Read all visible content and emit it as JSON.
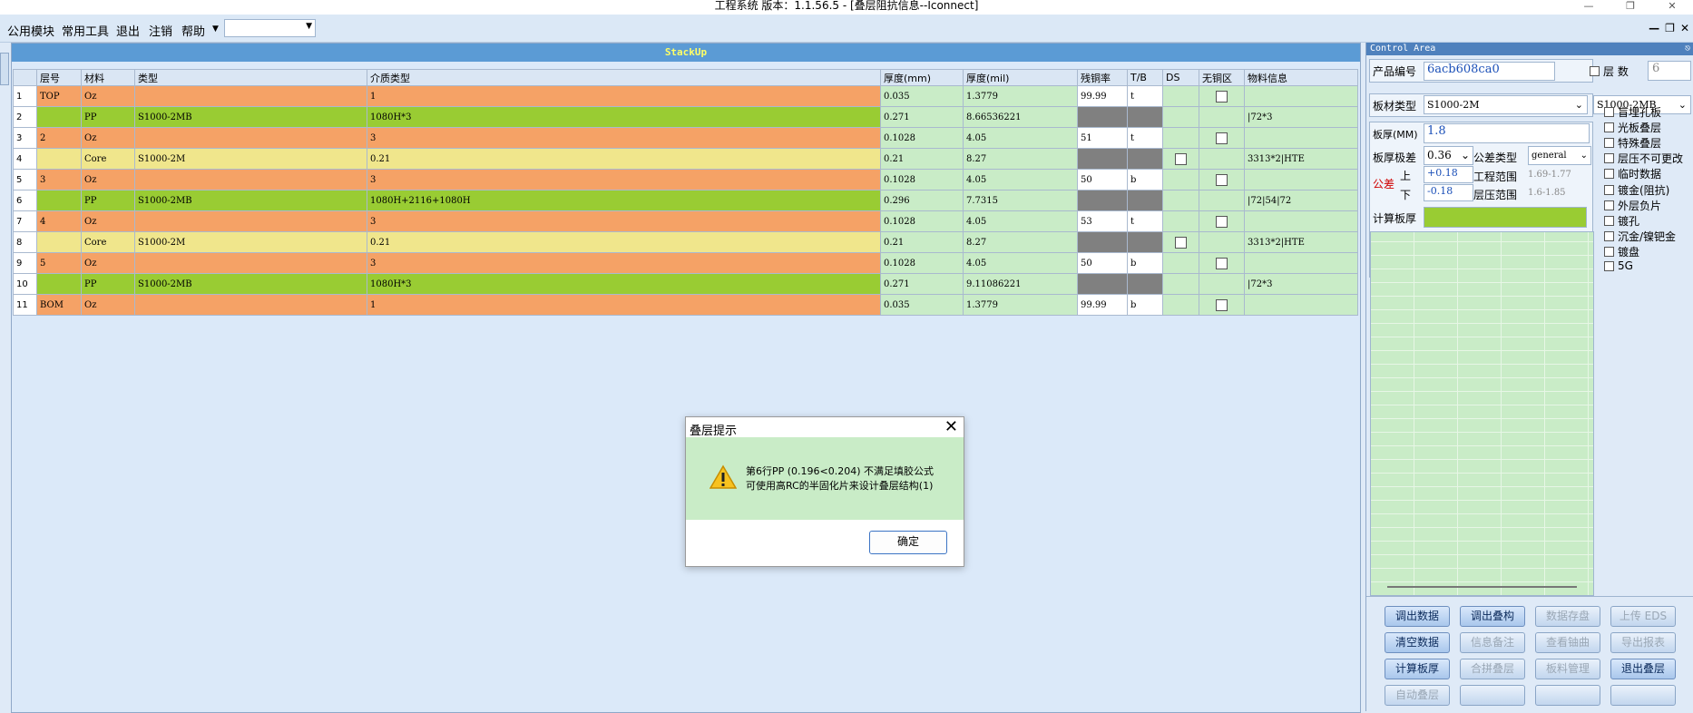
{
  "window": {
    "title": "工程系统   版本：1.1.56.5 - [叠层阻抗信息--Iconnect]"
  },
  "menu": {
    "items": [
      "公用模块",
      "常用工具",
      "退出",
      "注销",
      "帮助"
    ],
    "combo_value": ""
  },
  "stackup": {
    "title": "StackUp",
    "columns": [
      "层号",
      "材料",
      "类型",
      "介质类型",
      "厚度(mm)",
      "厚度(mil)",
      "残铜率",
      "T/B",
      "DS",
      "无铜区",
      "物料信息"
    ],
    "rows": [
      {
        "n": "1",
        "layer": "TOP",
        "mat": "Oz",
        "type": "",
        "diel": "1",
        "mm": "0.035",
        "mil": "1.3779",
        "cu": "99.99",
        "tb": "t",
        "info": ""
      },
      {
        "n": "2",
        "layer": "",
        "mat": "PP",
        "type": "S1000-2MB",
        "diel": "1080H*3",
        "mm": "0.271",
        "mil": "8.66536221",
        "cu": "",
        "tb": "",
        "info": "|72*3"
      },
      {
        "n": "3",
        "layer": "2",
        "mat": "Oz",
        "type": "",
        "diel": "3",
        "mm": "0.1028",
        "mil": "4.05",
        "cu": "51",
        "tb": "t",
        "info": ""
      },
      {
        "n": "4",
        "layer": "",
        "mat": "Core",
        "type": "S1000-2M",
        "diel": "0.21",
        "mm": "0.21",
        "mil": "8.27",
        "cu": "",
        "tb": "",
        "info": "3313*2|HTE"
      },
      {
        "n": "5",
        "layer": "3",
        "mat": "Oz",
        "type": "",
        "diel": "3",
        "mm": "0.1028",
        "mil": "4.05",
        "cu": "50",
        "tb": "b",
        "info": ""
      },
      {
        "n": "6",
        "layer": "",
        "mat": "PP",
        "type": "S1000-2MB",
        "diel": "1080H+2116+1080H",
        "mm": "0.296",
        "mil": "7.7315",
        "cu": "",
        "tb": "",
        "info": "|72|54|72"
      },
      {
        "n": "7",
        "layer": "4",
        "mat": "Oz",
        "type": "",
        "diel": "3",
        "mm": "0.1028",
        "mil": "4.05",
        "cu": "53",
        "tb": "t",
        "info": ""
      },
      {
        "n": "8",
        "layer": "",
        "mat": "Core",
        "type": "S1000-2M",
        "diel": "0.21",
        "mm": "0.21",
        "mil": "8.27",
        "cu": "",
        "tb": "",
        "info": "3313*2|HTE"
      },
      {
        "n": "9",
        "layer": "5",
        "mat": "Oz",
        "type": "",
        "diel": "3",
        "mm": "0.1028",
        "mil": "4.05",
        "cu": "50",
        "tb": "b",
        "info": ""
      },
      {
        "n": "10",
        "layer": "",
        "mat": "PP",
        "type": "S1000-2MB",
        "diel": "1080H*3",
        "mm": "0.271",
        "mil": "9.11086221",
        "cu": "",
        "tb": "",
        "info": "|72*3"
      },
      {
        "n": "11",
        "layer": "BOM",
        "mat": "Oz",
        "type": "",
        "diel": "1",
        "mm": "0.035",
        "mil": "1.3779",
        "cu": "99.99",
        "tb": "b",
        "info": ""
      }
    ]
  },
  "control": {
    "title": "Control Area",
    "product_label": "产品编号",
    "product_value": "6acb608ca0",
    "layers_label": "层 数",
    "layers_value": "6",
    "board_type_label": "板材类型",
    "board_type_value": "S1000-2M",
    "board_type_value2": "S1000-2MB",
    "thickness_label": "板厚(MM)",
    "thickness_value": "1.8",
    "tol_label": "板厚极差",
    "tol_value": "0.36",
    "tol_type_label": "公差类型",
    "tol_type_value": "general",
    "gongcha": "公差",
    "up": "上",
    "down": "下",
    "up_value": "+0.18",
    "down_value": "-0.18",
    "eng_range_label": "工程范围",
    "eng_range_value": "1.69-1.77",
    "press_range_label": "层压范围",
    "press_range_value": "1.6-1.85",
    "calc_label": "计算板厚",
    "checks": [
      "盲埋孔板",
      "光板叠层",
      "特殊叠层",
      "层压不可更改",
      "临时数据",
      "镀金(阻抗)",
      "外层负片",
      "镀孔",
      "沉金/镍钯金",
      "镀盘",
      "5G"
    ],
    "buttons": [
      "调出数据",
      "调出叠构",
      "数据存盘",
      "上传 EDS",
      "清空数据",
      "信息备注",
      "查看铀曲",
      "导出报表",
      "计算板厚",
      "合拼叠层",
      "板料管理",
      "退出叠层",
      "自动叠层",
      "",
      "",
      ""
    ]
  },
  "dialog": {
    "title": "叠层提示",
    "line1": "第6行PP (0.196<0.204) 不满足填胶公式",
    "line2": "可使用高RC的半固化片来设计叠层结构(1)",
    "ok": "确定"
  }
}
